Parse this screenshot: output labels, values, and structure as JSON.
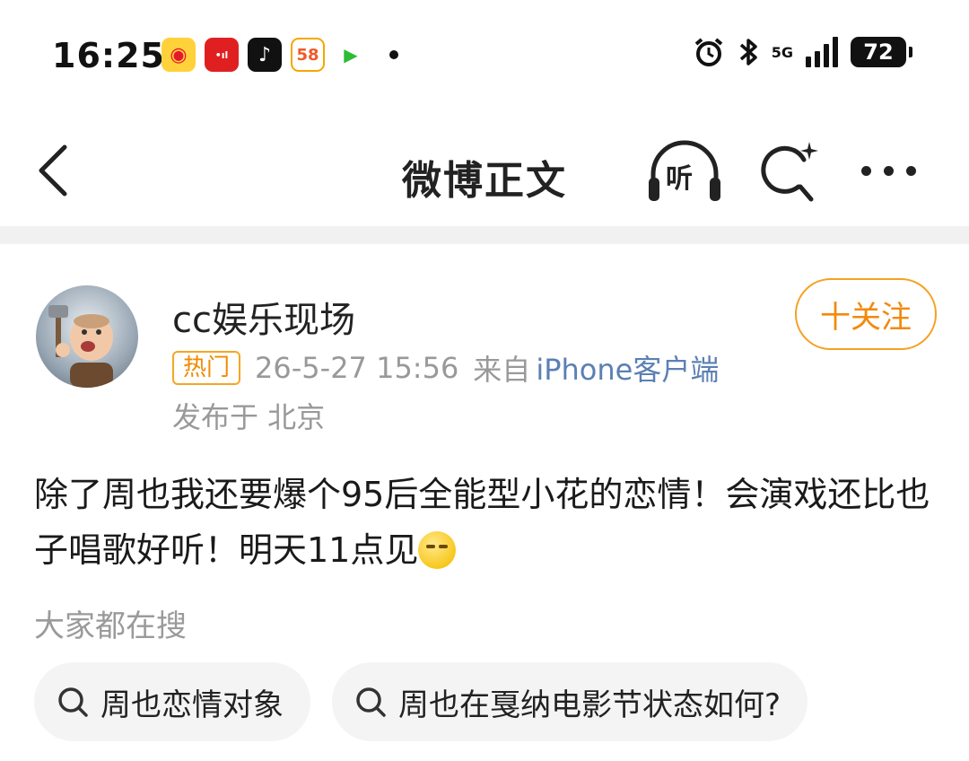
{
  "status_bar": {
    "time": "16:25",
    "apps": [
      {
        "name": "weibo",
        "glyph": "◉"
      },
      {
        "name": "red-app",
        "glyph": "•ıl"
      },
      {
        "name": "tiktok",
        "glyph": "♪"
      },
      {
        "name": "58",
        "glyph": "58"
      },
      {
        "name": "iqiyi",
        "glyph": "▶"
      }
    ],
    "network": "5G",
    "battery": "72"
  },
  "nav": {
    "title": "微博正文",
    "listen_label": "听"
  },
  "post": {
    "author": "cc娱乐现场",
    "follow_label": "十关注",
    "hot_badge": "热门",
    "datetime": "26-5-27 15:56",
    "from_prefix": "来自",
    "source": "iPhone客户端",
    "location": "发布于 北京",
    "text": "除了周也我还要爆个95后全能型小花的恋情！会演戏还比也子唱歌好听！明天11点见"
  },
  "search": {
    "label": "大家都在搜",
    "chips": [
      {
        "text": "周也恋情对象"
      },
      {
        "text": "周也在戛纳电影节状态如何?"
      }
    ]
  }
}
